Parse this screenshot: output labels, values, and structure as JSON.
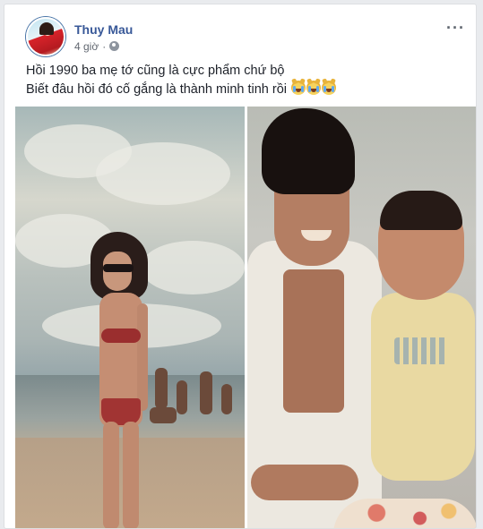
{
  "post": {
    "author": "Thuy Mau",
    "time": "4 giờ",
    "time_separator": "·",
    "privacy_icon": "globe-icon",
    "more_label": "···",
    "text_line_1": "Hồi 1990 ba mẹ tớ cũng là cực phẩm chứ bộ",
    "text_line_2": "Biết đâu hồi đó cố gắng là thành minh tinh rồi",
    "emojis": [
      "crying-laughing-cat-emoji",
      "crying-laughing-cat-emoji",
      "crying-laughing-cat-emoji"
    ]
  },
  "photos": [
    {
      "subject": "woman-in-red-bikini-on-beach"
    },
    {
      "subject": "man-holding-baby"
    }
  ],
  "colors": {
    "author_link": "#385898",
    "meta_text": "#616770",
    "body_text": "#1d2129",
    "background": "#e9ebee",
    "card": "#ffffff"
  }
}
